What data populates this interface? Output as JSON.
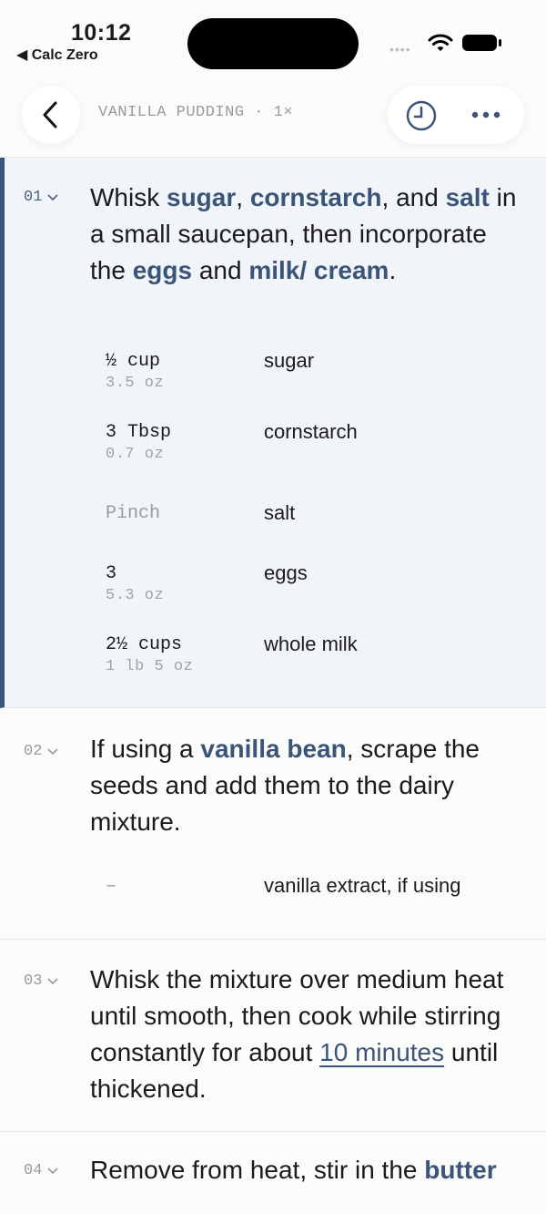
{
  "status": {
    "time": "10:12",
    "back_app": "◀ Calc Zero",
    "signal_dots": "••••"
  },
  "header": {
    "title": "VANILLA PUDDING · 1×"
  },
  "icons": {
    "back": "chevron-left-icon",
    "history": "clock-icon",
    "more": "ellipsis-icon"
  },
  "colors": {
    "accent": "#3b5578",
    "active_bg": "#f1f4f8"
  },
  "steps": [
    {
      "num": "01",
      "text_parts": [
        "Whisk ",
        "sugar",
        ", ",
        "cornstarch",
        ", and ",
        "salt",
        " in a small saucepan, then incorporate the ",
        "eggs",
        " and ",
        "milk/ cream",
        "."
      ],
      "ingredients": [
        {
          "qty": "½ cup",
          "sub": "3.5 oz",
          "name": "sugar"
        },
        {
          "qty": "3 Tbsp",
          "sub": "0.7 oz",
          "name": "cornstarch"
        },
        {
          "qty": "Pinch",
          "sub": "",
          "name": "salt"
        },
        {
          "qty": "3",
          "sub": "5.3 oz",
          "name": "eggs"
        },
        {
          "qty": "2½ cups",
          "sub": "1 lb 5 oz",
          "name": "whole milk"
        }
      ]
    },
    {
      "num": "02",
      "text_parts": [
        "If using a ",
        "vanilla bean",
        ", scrape the seeds and add them to the dairy mixture."
      ],
      "ingredients": [
        {
          "qty": "–",
          "sub": "",
          "name": "vanilla extract, if using"
        }
      ]
    },
    {
      "num": "03",
      "text_parts": [
        "Whisk the mixture over medium heat until smooth, then cook while stirring constantly for about ",
        "10 minutes",
        " until thickened."
      ]
    },
    {
      "num": "04",
      "text_parts": [
        "Remove from heat, stir in the ",
        "butter"
      ]
    }
  ]
}
